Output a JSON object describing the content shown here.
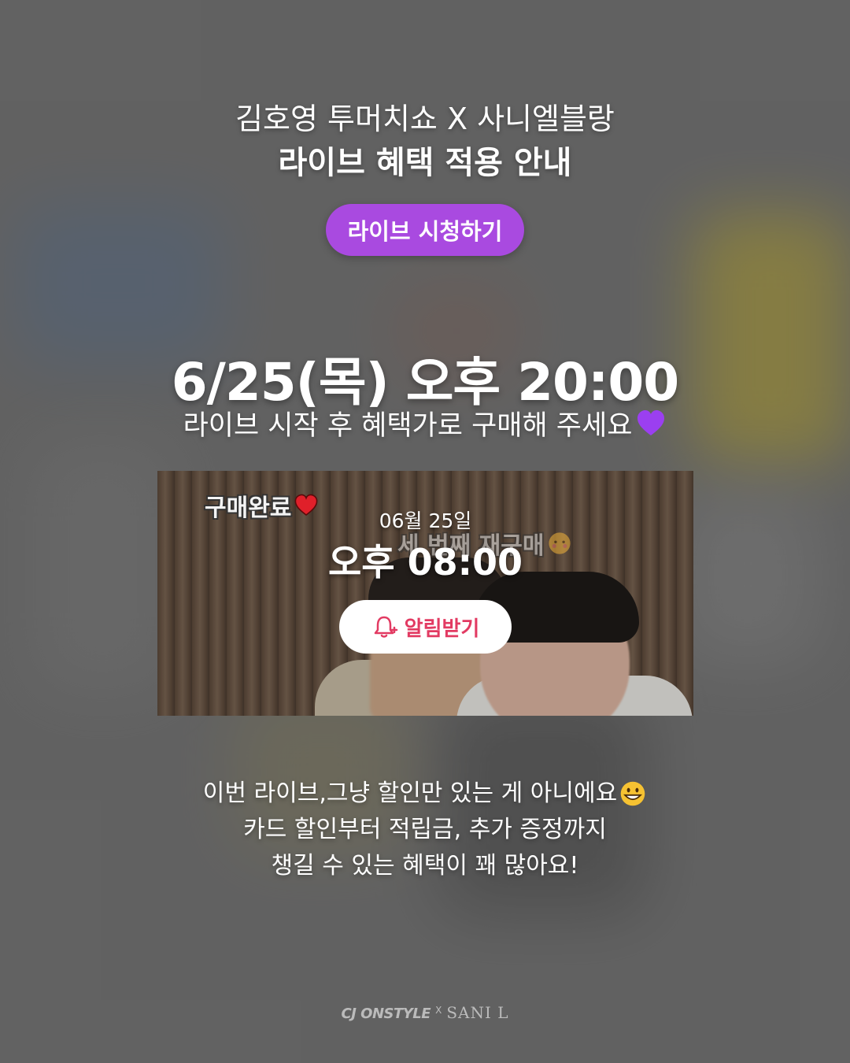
{
  "header": {
    "line1": "김호영 투머치쇼 X 사니엘블랑",
    "line2": "라이브 혜택 적용 안내"
  },
  "watch_button": {
    "label": "라이브 시청하기",
    "color": "#a94ae0"
  },
  "schedule": {
    "datetime": "6/25(목) 오후 20:00",
    "note": "라이브 시작 후 혜택가로 구매해 주세요"
  },
  "video": {
    "overlay_purchase": "구매완료",
    "overlay_repurchase": "세 번째 재구매",
    "date": "06월 25일",
    "time": "오후 08:00",
    "alarm_label": "알림받기",
    "alarm_color": "#e23a62"
  },
  "description": {
    "line1": "이번 라이브,그냥 할인만 있는 게 아니에요",
    "line2": "카드 할인부터 적립금, 추가 증정까지",
    "line3": "챙길 수 있는 혜택이 꽤 많아요!"
  },
  "footer": {
    "brand_left": "CJ ONSTYLE",
    "separator": "X",
    "brand_right": "SANI L"
  }
}
